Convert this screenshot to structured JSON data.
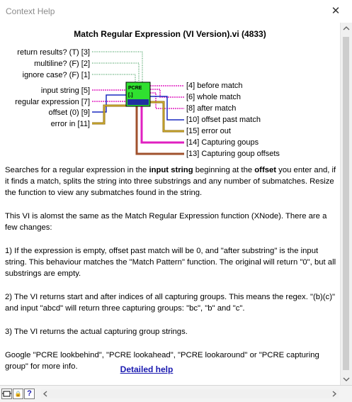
{
  "window": {
    "title": "Context Help",
    "close_glyph": "✕"
  },
  "vi_title": "Match Regular Expression (VI Version).vi (4833)",
  "icon_label": {
    "line1": "PCRE",
    "line2": "[.]"
  },
  "inputs": [
    "return results? (T) [3]",
    "multiline? (F) [2]",
    "ignore case? (F) [1]",
    "input string [5]",
    "regular expression [7]",
    "offset (0) [9]",
    "error in [11]"
  ],
  "outputs": [
    "[4] before match",
    "[6] whole match",
    "[8] after match",
    "[10] offset past match",
    "[15] error out",
    "[14] Capturing goups",
    "[13] Capturing goup offsets"
  ],
  "description": {
    "p1_a": "Searches for a regular expression in the ",
    "p1_b": "input string",
    "p1_c": " beginning at the ",
    "p1_d": "offset",
    "p1_e": " you enter and, if it finds a match, splits the string into three substrings and any number of submatches. Resize the function to view any submatches found in the string.",
    "p2": "This VI is alomst the same as the Match Regular Expression function (XNode). There are a few changes:",
    "p3": "1) If the expression is empty, offset past match will be 0, and \"after substring\" is the input string. This behaviour matches the \"Match Pattern\" function. The original will return \"0\", but all substrings are empty.",
    "p4": "2) The VI returns start and after indices of all capturing groups. This means the regex. \"(b)(c)\" and input \"abcd\" will return three capturing groups: \"bc\", \"b\" and \"c\".",
    "p5": "3) The VI returns the actual capturing group strings.",
    "p6": "Google \"PCRE lookbehind\", \"PCRE lookahead\", \"PCRE lookaround\"  or \"PCRE capturing group\" for more info."
  },
  "help_link": "Detailed help",
  "bottom_buttons": {
    "lock": "🔒",
    "help": "?"
  },
  "colors": {
    "boolean_wire": "#1a8a3c",
    "string_wire": "#e020c0",
    "number_wire": "#1a2ac0",
    "error_wire": "#8c6a10",
    "cluster_wire": "#a0522d",
    "icon_bg": "#30e030"
  }
}
